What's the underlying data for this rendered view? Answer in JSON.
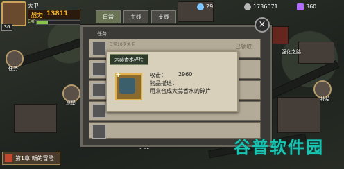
{
  "player": {
    "name": "大卫",
    "level": "36",
    "power_label": "战力",
    "power_value": "13811",
    "exp_label": "EXP",
    "exp_fraction": 0.25
  },
  "resources": [
    {
      "name": "battery",
      "value": "29",
      "color": "#7bc6ff"
    },
    {
      "name": "coins",
      "value": "1736071",
      "color": "#b7b7b7"
    },
    {
      "name": "gems",
      "value": "360",
      "color": "#b36cff"
    }
  ],
  "map_labels": {
    "left_mid": "任务",
    "left_lower": "巡堡",
    "right_upper": "强化之路",
    "right_mid": "补给",
    "bottom_mid": "梦魇"
  },
  "quest_panel": {
    "tabs": [
      "日常",
      "主线",
      "支线"
    ],
    "active_tab": 0,
    "section_title": "任务",
    "first_row_text": "日常10次关卡",
    "claimed_status": "已领取"
  },
  "item_popup": {
    "title": "大蒜香水碎片",
    "attack_label": "攻击：",
    "attack_value": "2960",
    "desc_label": "物品描述：",
    "desc_text": "用来合成大蒜香水的碎片"
  },
  "chapter": {
    "label": "第1章 新的冒险"
  },
  "watermark": "谷普软件园"
}
